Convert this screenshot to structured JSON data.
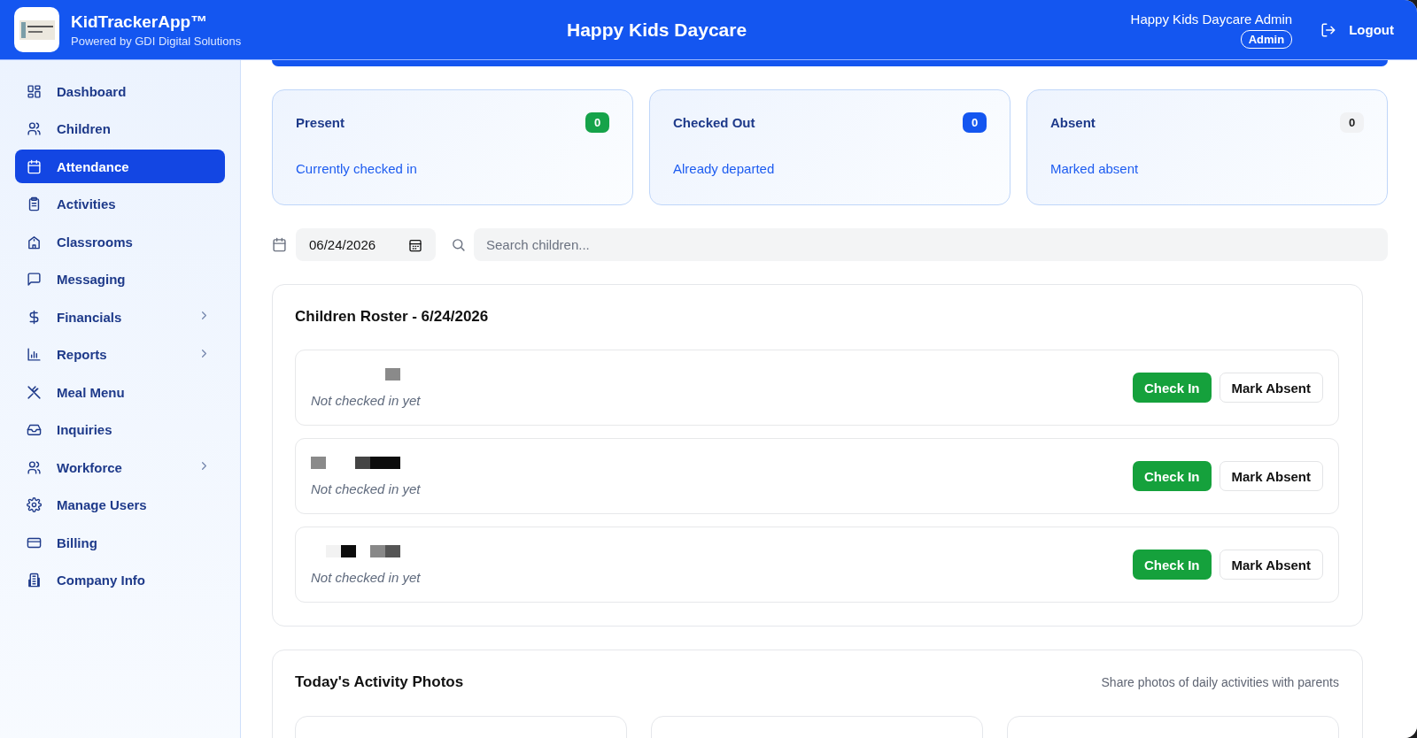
{
  "header": {
    "app_name": "KidTrackerApp™",
    "tagline": "Powered by GDI Digital Solutions",
    "title": "Happy Kids Daycare",
    "user_name": "Happy Kids Daycare Admin",
    "role": "Admin",
    "logout": "Logout"
  },
  "sidebar": {
    "items": [
      {
        "label": "Dashboard",
        "selected": false,
        "expandable": false
      },
      {
        "label": "Children",
        "selected": false,
        "expandable": false
      },
      {
        "label": "Attendance",
        "selected": true,
        "expandable": false
      },
      {
        "label": "Activities",
        "selected": false,
        "expandable": false
      },
      {
        "label": "Classrooms",
        "selected": false,
        "expandable": false
      },
      {
        "label": "Messaging",
        "selected": false,
        "expandable": false
      },
      {
        "label": "Financials",
        "selected": false,
        "expandable": true
      },
      {
        "label": "Reports",
        "selected": false,
        "expandable": true
      },
      {
        "label": "Meal Menu",
        "selected": false,
        "expandable": false
      },
      {
        "label": "Inquiries",
        "selected": false,
        "expandable": false
      },
      {
        "label": "Workforce",
        "selected": false,
        "expandable": true
      },
      {
        "label": "Manage Users",
        "selected": false,
        "expandable": false
      },
      {
        "label": "Billing",
        "selected": false,
        "expandable": false
      },
      {
        "label": "Company Info",
        "selected": false,
        "expandable": false
      }
    ]
  },
  "stats": [
    {
      "title": "Present",
      "count": "0",
      "color": "#16a34a",
      "caption": "Currently checked in"
    },
    {
      "title": "Checked Out",
      "count": "0",
      "color": "#1456f0",
      "caption": "Already departed"
    },
    {
      "title": "Absent",
      "count": "0",
      "color": "#f1f2f4",
      "caption": "Marked absent"
    }
  ],
  "filters": {
    "date": "06/24/2026",
    "search_placeholder": "Search children..."
  },
  "roster": {
    "title": "Children Roster - 6/24/2026",
    "rows": [
      {
        "name": {
          "kind": "redacted"
        },
        "status": "Not checked in yet",
        "check_in": "Check In",
        "mark_absent": "Mark Absent"
      },
      {
        "name": {
          "kind": "redacted"
        },
        "status": "Not checked in yet",
        "check_in": "Check In",
        "mark_absent": "Mark Absent"
      },
      {
        "name": {
          "kind": "redacted"
        },
        "status": "Not checked in yet",
        "check_in": "Check In",
        "mark_absent": "Mark Absent"
      }
    ]
  },
  "photos": {
    "title": "Today's Activity Photos",
    "subtitle": "Share photos of daily activities with parents"
  }
}
